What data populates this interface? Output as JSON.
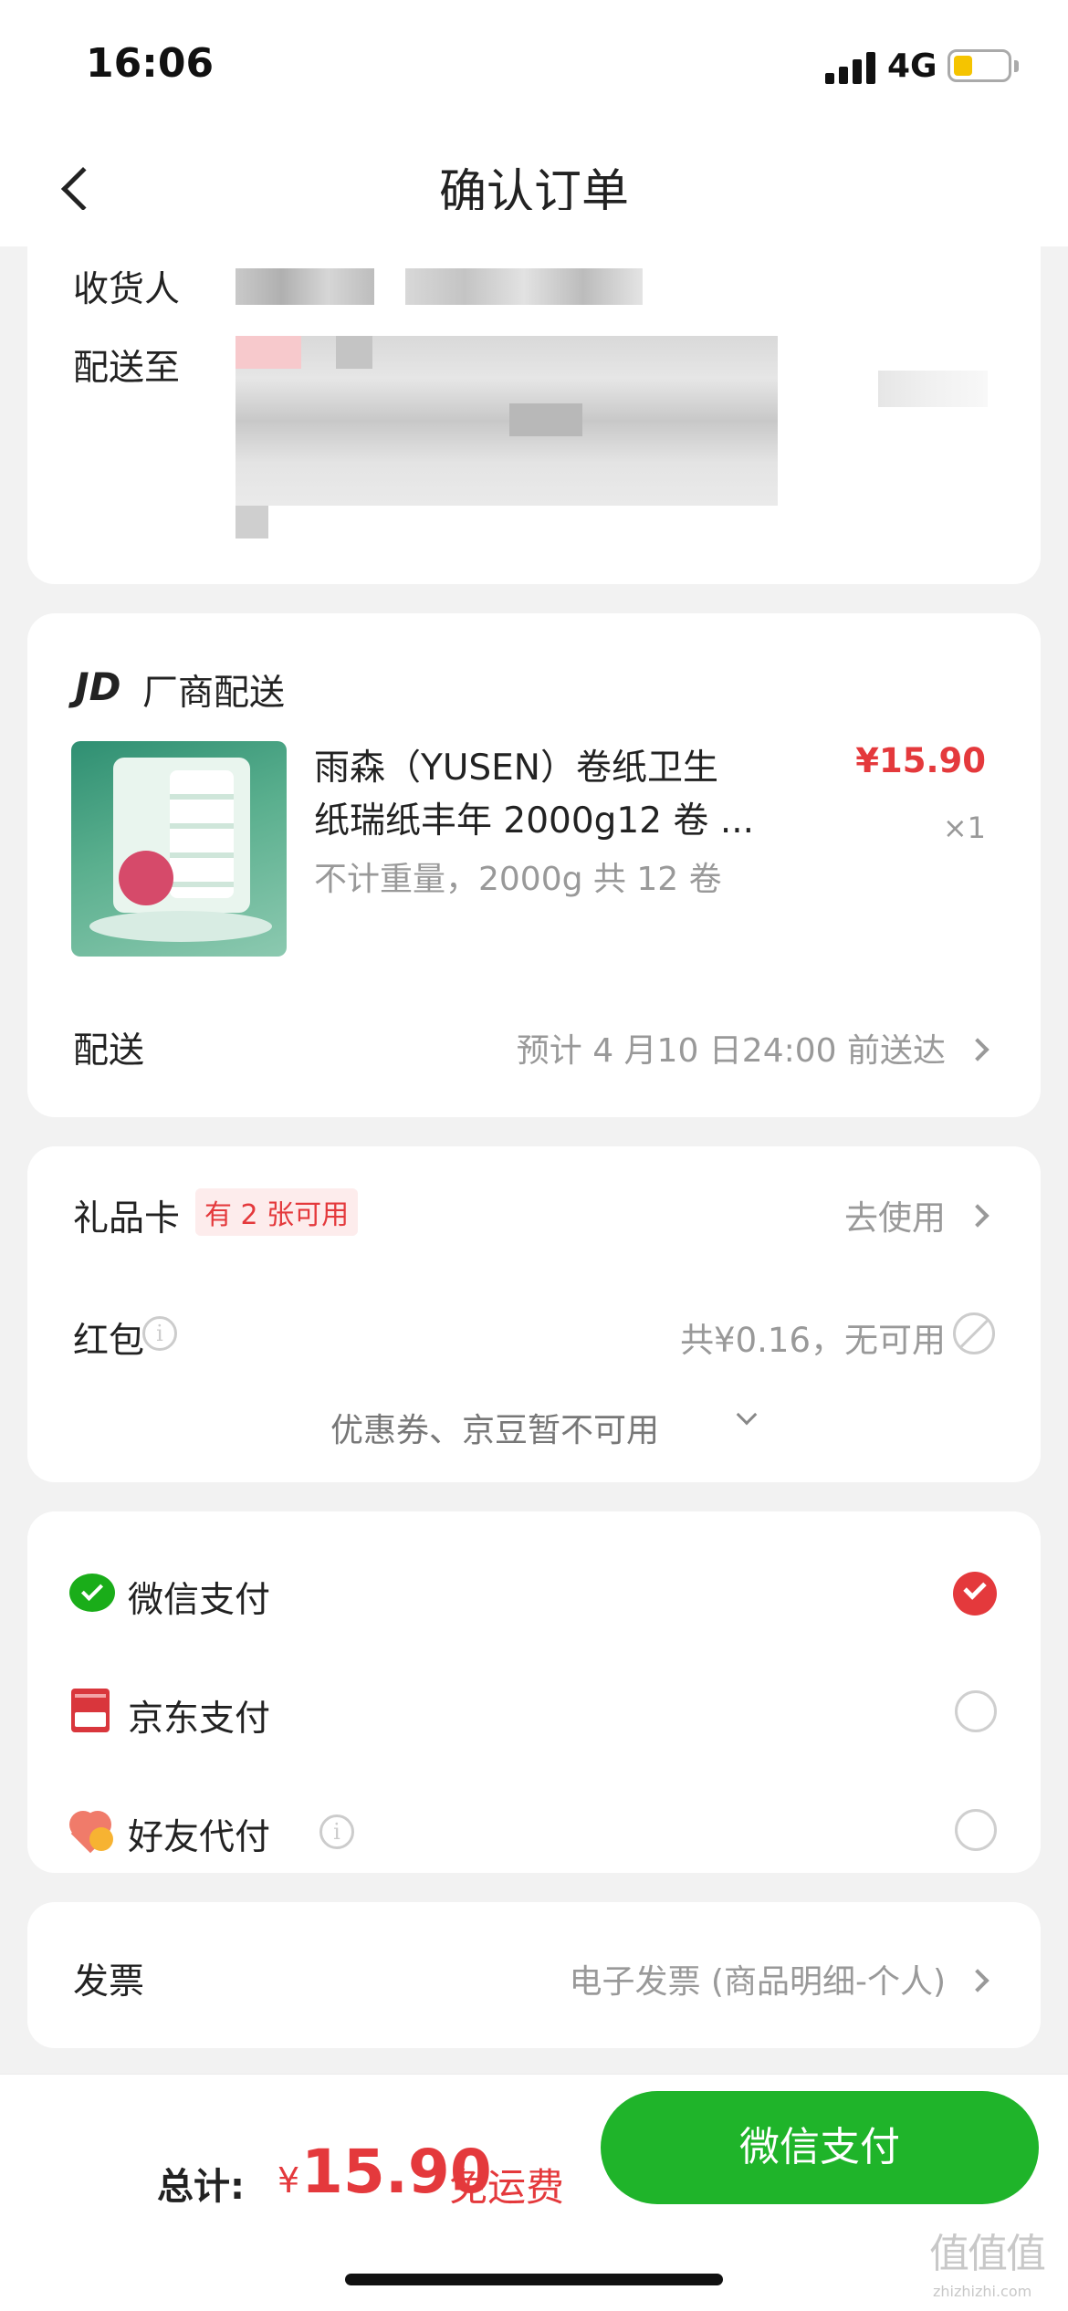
{
  "status": {
    "time": "16:06",
    "network": "4G"
  },
  "nav": {
    "title": "确认订单"
  },
  "address": {
    "recipient_label": "收货人",
    "dest_label": "配送至"
  },
  "shop": {
    "logo": "JD",
    "name": "厂商配送"
  },
  "product": {
    "name_line1": "雨森（YUSEN）卷纸卫生",
    "name_line2": "纸瑞纸丰年 2000g12 卷 ...",
    "spec": "不计重量，2000g 共 12 卷",
    "price": "¥15.90",
    "qty": "×1",
    "image_icon": "toilet-paper-product-image"
  },
  "delivery": {
    "label": "配送",
    "value": "预计 4 月10 日24:00 前送达"
  },
  "giftcard": {
    "label": "礼品卡",
    "badge": "有 2 张可用",
    "action": "去使用"
  },
  "redpacket": {
    "label": "红包",
    "value": "共¥0.16，无可用"
  },
  "coupon_note": "优惠券、京豆暂不可用",
  "payments": [
    {
      "label": "微信支付",
      "selected": true,
      "icon": "wechat-pay-icon"
    },
    {
      "label": "京东支付",
      "selected": false,
      "icon": "jd-pay-icon"
    },
    {
      "label": "好友代付",
      "selected": false,
      "icon": "friend-pay-icon"
    }
  ],
  "invoice": {
    "label": "发票",
    "value": "电子发票 (商品明细-个人)"
  },
  "footer": {
    "total_label": "总计:",
    "currency": "¥",
    "amount": "15.90",
    "shipping": "免运费",
    "pay_button": "微信支付"
  },
  "watermark": {
    "text": "值值值",
    "site": "zhizhizhi.com"
  },
  "colors": {
    "accent_red": "#e4393c",
    "wechat_green": "#1aad19",
    "pay_button": "#1fb42a",
    "background": "#f2f2f2"
  }
}
